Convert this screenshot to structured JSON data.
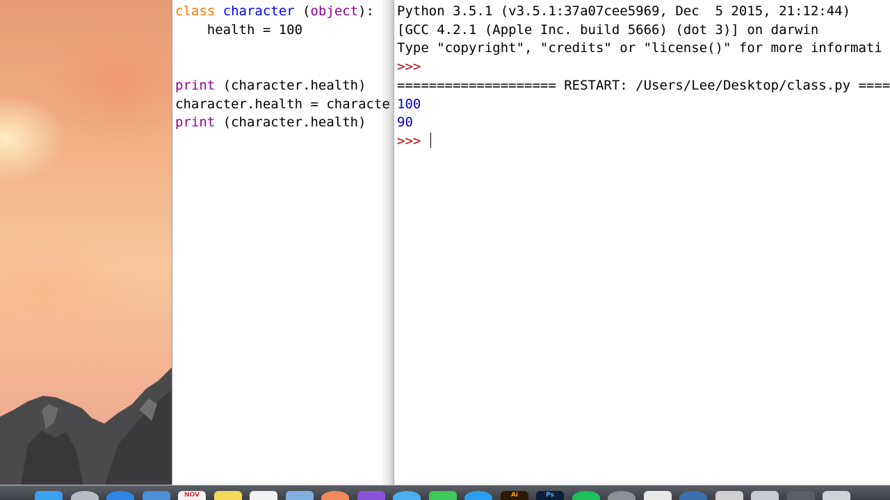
{
  "editor": {
    "lines": [
      [
        {
          "t": "class",
          "c": "kw"
        },
        {
          "t": " "
        },
        {
          "t": "character",
          "c": "def"
        },
        {
          "t": " ("
        },
        {
          "t": "object",
          "c": "bi"
        },
        {
          "t": "):"
        }
      ],
      [
        {
          "t": "    health = 100"
        }
      ],
      [
        {
          "t": ""
        }
      ],
      [
        {
          "t": ""
        }
      ],
      [
        {
          "t": "print",
          "c": "bi"
        },
        {
          "t": " (character.health)"
        }
      ],
      [
        {
          "t": "character.health = characte"
        }
      ],
      [
        {
          "t": "print",
          "c": "bi"
        },
        {
          "t": " (character.health)"
        }
      ]
    ]
  },
  "shell": {
    "lines": [
      [
        {
          "t": "Python 3.5.1 (v3.5.1:37a07cee5969, Dec  5 2015, 21:12:44)"
        }
      ],
      [
        {
          "t": "[GCC 4.2.1 (Apple Inc. build 5666) (dot 3)] on darwin"
        }
      ],
      [
        {
          "t": "Type \"copyright\", \"credits\" or \"license()\" for more informati"
        }
      ],
      [
        {
          "t": ">>> ",
          "c": "prompt"
        }
      ],
      [
        {
          "t": "==================== RESTART: /Users/Lee/Desktop/class.py ===="
        }
      ],
      [
        {
          "t": "100",
          "c": "stdout"
        }
      ],
      [
        {
          "t": "90",
          "c": "stdout"
        }
      ],
      [
        {
          "t": ">>> ",
          "c": "prompt"
        },
        {
          "t": "",
          "cursor": true
        }
      ]
    ]
  },
  "dock": {
    "items": [
      {
        "name": "finder-icon",
        "color": "#3aa0f0"
      },
      {
        "name": "launchpad-icon",
        "color": "#b8bcc4",
        "round": true
      },
      {
        "name": "safari-icon",
        "color": "#2f86e8",
        "round": true
      },
      {
        "name": "mail-icon",
        "color": "#4a8fd8"
      },
      {
        "name": "calendar-icon",
        "color": "#f4f4f4",
        "label": "NOV"
      },
      {
        "name": "notes-icon",
        "color": "#f6d85a"
      },
      {
        "name": "reminders-icon",
        "color": "#f2f2f2"
      },
      {
        "name": "preview-icon",
        "color": "#7fb0e0"
      },
      {
        "name": "photos-icon",
        "color": "#f08a5a",
        "round": true
      },
      {
        "name": "imovie-icon",
        "color": "#8a52d8"
      },
      {
        "name": "messages-icon",
        "color": "#4ab0f0",
        "round": true
      },
      {
        "name": "facetime-icon",
        "color": "#3cc85a"
      },
      {
        "name": "app-store-icon",
        "color": "#2a9ef0",
        "round": true
      },
      {
        "name": "illustrator-icon",
        "color": "#2b1a04",
        "label": "Ai"
      },
      {
        "name": "photoshop-icon",
        "color": "#0c1e3a",
        "label": "Ps"
      },
      {
        "name": "spotify-icon",
        "color": "#1ec05c",
        "round": true
      },
      {
        "name": "system-preferences-icon",
        "color": "#8c9096",
        "round": true
      },
      {
        "name": "textedit-icon",
        "color": "#e8e8e8"
      },
      {
        "name": "python-launcher-icon",
        "color": "#3b6fb0",
        "round": true
      },
      {
        "name": "script-icon",
        "color": "#d0d0d0"
      },
      {
        "name": "folder-icon",
        "color": "#c8ccd2"
      },
      {
        "name": "screenshot-icon",
        "color": "#5a5e66"
      },
      {
        "name": "trash-icon",
        "color": "#cfd2d6"
      }
    ]
  }
}
